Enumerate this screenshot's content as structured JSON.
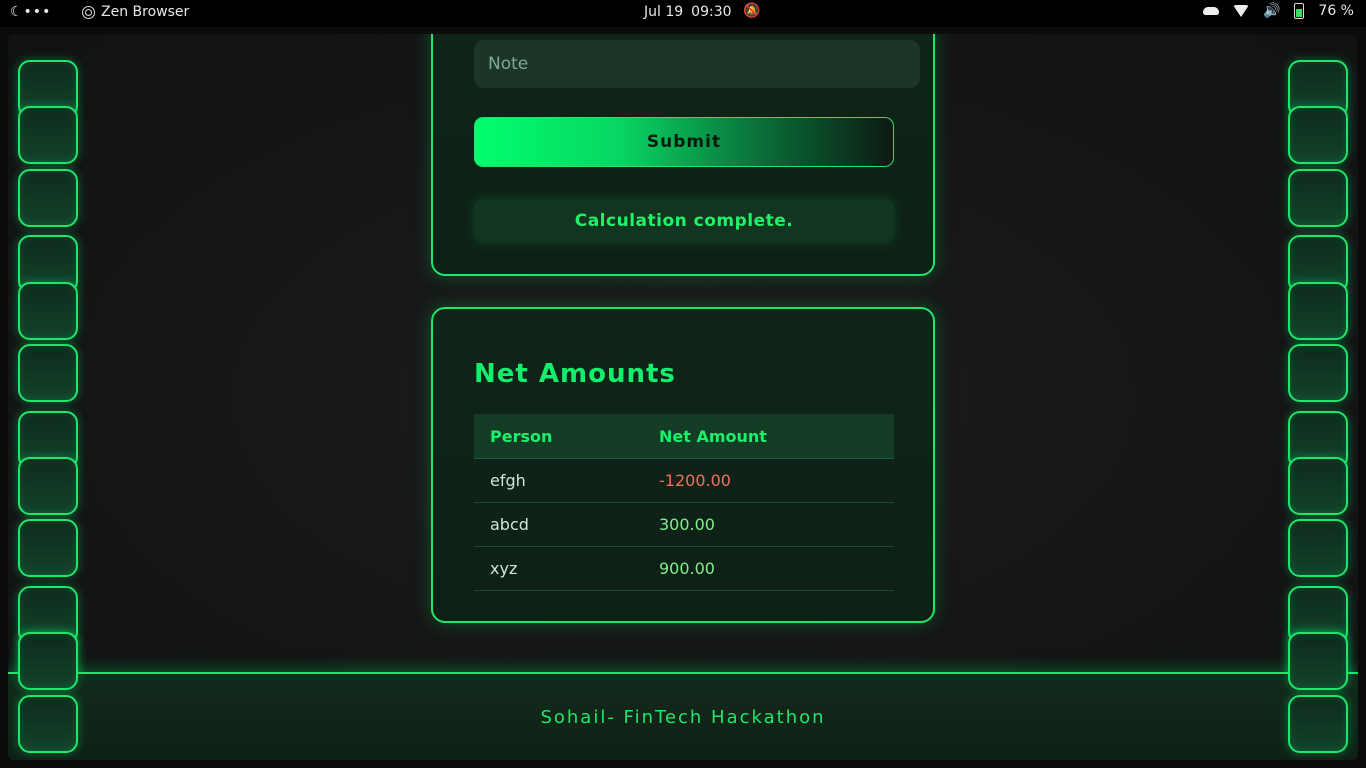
{
  "topbar": {
    "activities": "☾•••",
    "app_name": "Zen Browser",
    "date": "Jul 19",
    "time": "09:30",
    "battery": "76 %"
  },
  "form": {
    "note_placeholder": "Note",
    "submit_label": "Submit",
    "status_text": "Calculation complete."
  },
  "net_amounts": {
    "title": "Net Amounts",
    "headers": [
      "Person",
      "Net Amount"
    ],
    "rows": [
      {
        "person": "efgh",
        "amount": "-1200.00"
      },
      {
        "person": "abcd",
        "amount": "300.00"
      },
      {
        "person": "xyz",
        "amount": "900.00"
      }
    ]
  },
  "footer": {
    "text": "Sohail- FinTech Hackathon"
  },
  "colors": {
    "accent": "#1fe56a",
    "negative": "#f0705a",
    "positive": "#7ff08a"
  }
}
